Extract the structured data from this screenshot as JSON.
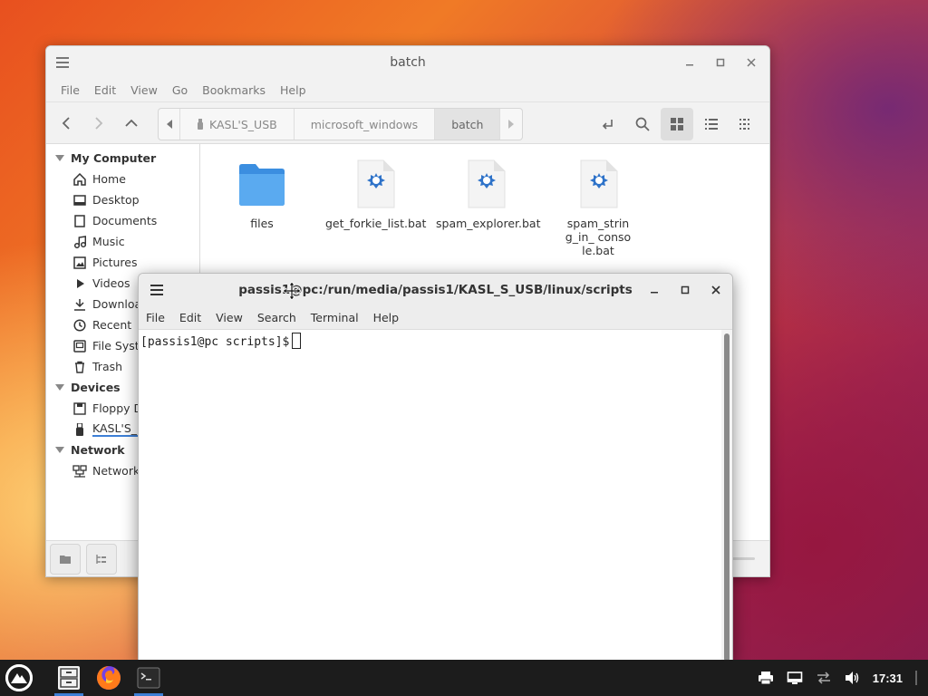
{
  "file_manager": {
    "title": "batch",
    "menu": [
      "File",
      "Edit",
      "View",
      "Go",
      "Bookmarks",
      "Help"
    ],
    "path": [
      "KASL'S_USB",
      "microsoft_windows",
      "batch"
    ],
    "sidebar": {
      "my_computer": {
        "label": "My Computer",
        "items": [
          "Home",
          "Desktop",
          "Documents",
          "Music",
          "Pictures",
          "Videos",
          "Download",
          "Recent",
          "File Syste",
          "Trash"
        ]
      },
      "devices": {
        "label": "Devices",
        "items": [
          "Floppy Di",
          "KASL'S_U"
        ]
      },
      "network": {
        "label": "Network",
        "items": [
          "Network"
        ]
      }
    },
    "files": [
      {
        "name": "files",
        "type": "folder-icon"
      },
      {
        "name": "get_forkie_list.bat",
        "type": "script-file-icon"
      },
      {
        "name": "spam_explorer.bat",
        "type": "script-file-icon"
      },
      {
        "name": "spam_string_in_ console.bat",
        "type": "script-file-icon"
      }
    ]
  },
  "terminal": {
    "title": "passis1@pc:/run/media/passis1/KASL_S_USB/linux/scripts",
    "menu": [
      "File",
      "Edit",
      "View",
      "Search",
      "Terminal",
      "Help"
    ],
    "prompt": "[passis1@pc scripts]$"
  },
  "taskbar": {
    "clock": "17:31",
    "apps": [
      "file-manager-icon",
      "firefox-icon",
      "terminal-icon"
    ],
    "tray": [
      "printer-icon",
      "display-icon",
      "network-icon",
      "volume-icon"
    ]
  },
  "colors": {
    "accent": "#3d7fd6",
    "folder": "#4a9ae6",
    "taskbar": "#1c1c1c"
  }
}
